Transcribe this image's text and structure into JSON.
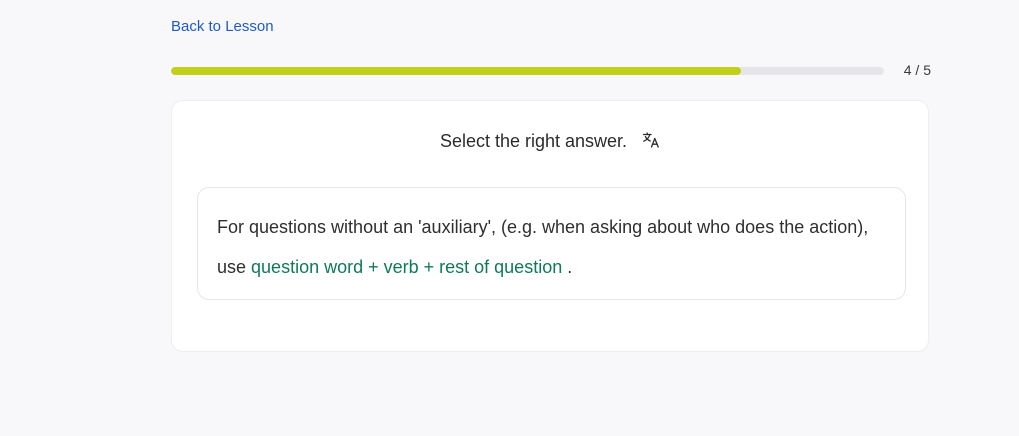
{
  "nav": {
    "back_label": "Back to Lesson"
  },
  "progress": {
    "current": 4,
    "total": 5,
    "fraction": 0.8,
    "label": "4 / 5",
    "fill_color": "#c2d01a",
    "track_color": "#e6e6ea"
  },
  "question": {
    "instruction": "Select the right answer.",
    "translate_icon": "translate-icon",
    "explanation_before": "For questions without an 'auxiliary', (e.g. when asking about who does the action), use ",
    "explanation_highlight": "question word + verb + rest of question",
    "explanation_after": " .",
    "highlight_color": "#0f7a55"
  },
  "colors": {
    "link": "#1f5bc4",
    "background": "#f8f8fa"
  }
}
